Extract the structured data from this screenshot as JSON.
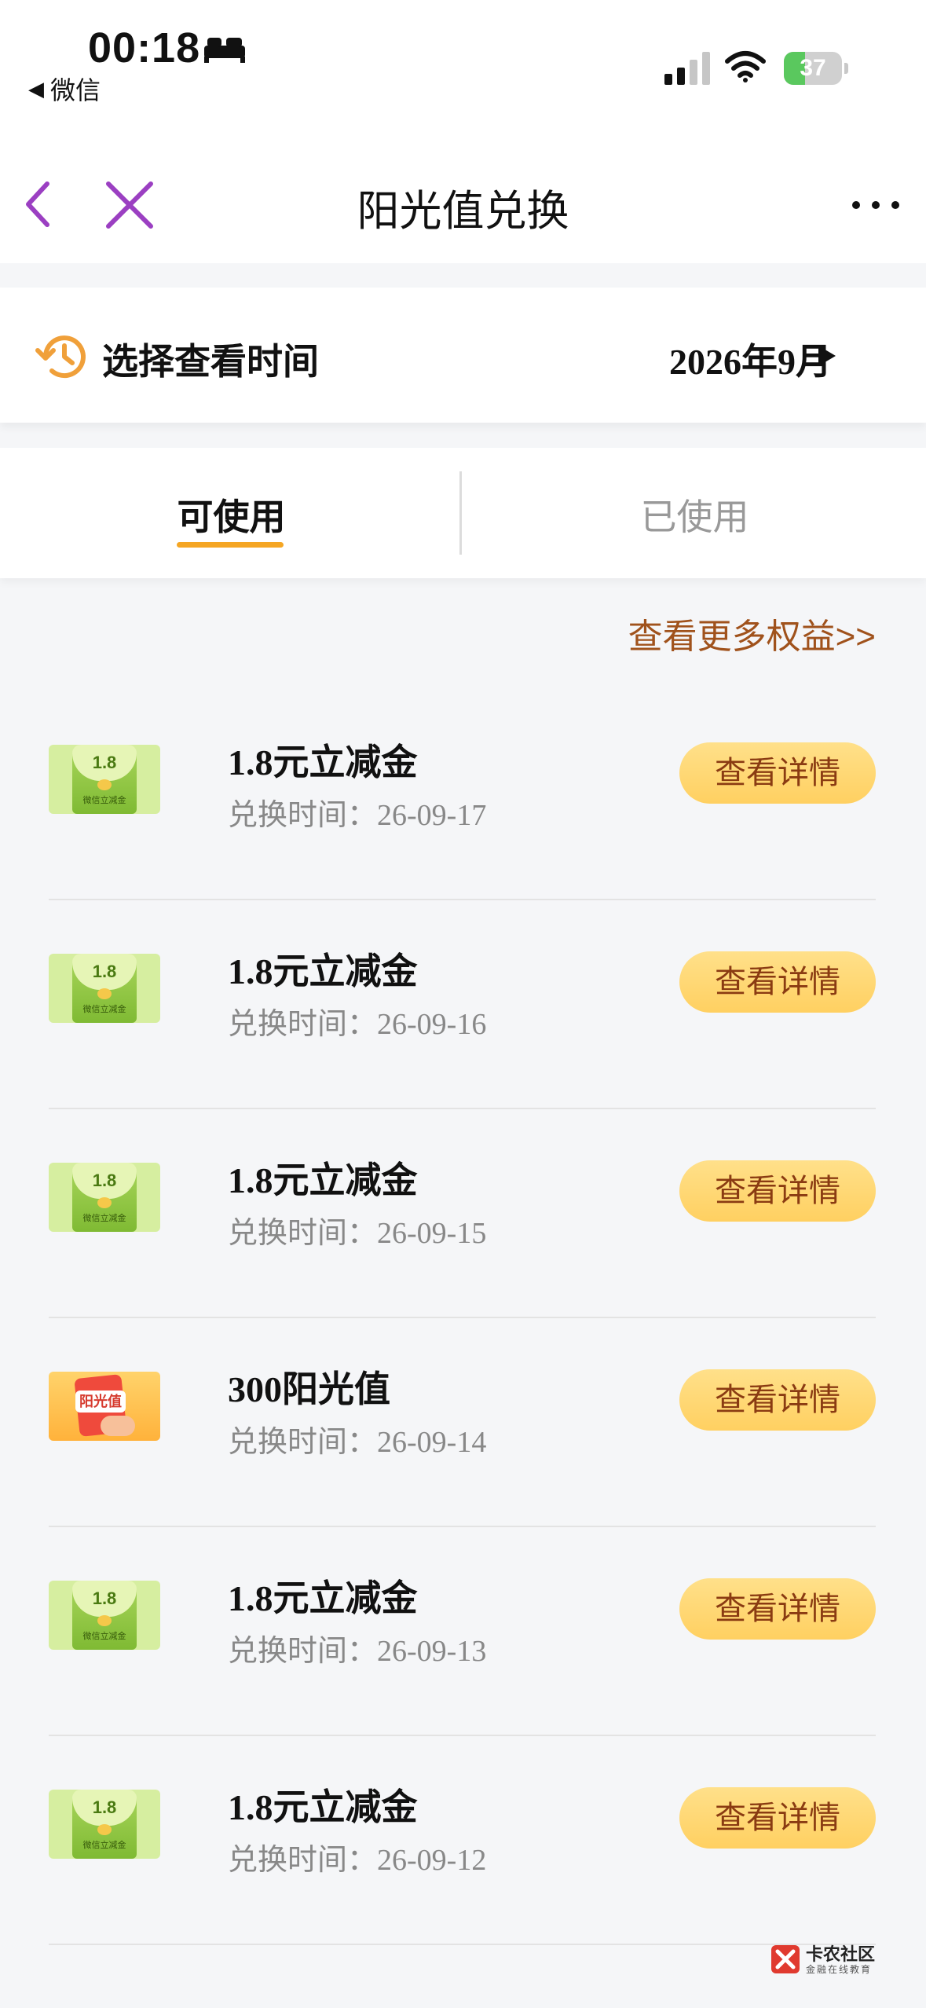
{
  "status_bar": {
    "time": "00:18",
    "back_app": "微信",
    "battery": "37",
    "battery_level": 0.37
  },
  "nav": {
    "title": "阳光值兑换"
  },
  "month_selector": {
    "label": "选择查看时间",
    "value": "2026年9月"
  },
  "tabs": [
    {
      "label": "可使用",
      "active": true
    },
    {
      "label": "已使用",
      "active": false
    }
  ],
  "more_link": "查看更多权益>>",
  "date_prefix": "兑换时间：",
  "items": [
    {
      "title": "1.8元立减金",
      "date": "26-09-17",
      "thumb_type": "green",
      "thumb_amount": "1.8",
      "thumb_caption": "微信立减金",
      "button": "查看详情"
    },
    {
      "title": "1.8元立减金",
      "date": "26-09-16",
      "thumb_type": "green",
      "thumb_amount": "1.8",
      "thumb_caption": "微信立减金",
      "button": "查看详情"
    },
    {
      "title": "1.8元立减金",
      "date": "26-09-15",
      "thumb_type": "green",
      "thumb_amount": "1.8",
      "thumb_caption": "微信立减金",
      "button": "查看详情"
    },
    {
      "title": "300阳光值",
      "date": "26-09-14",
      "thumb_type": "sun",
      "thumb_amount": "阳光值",
      "thumb_caption": "",
      "button": "查看详情"
    },
    {
      "title": "1.8元立减金",
      "date": "26-09-13",
      "thumb_type": "green",
      "thumb_amount": "1.8",
      "thumb_caption": "微信立减金",
      "button": "查看详情"
    },
    {
      "title": "1.8元立减金",
      "date": "26-09-12",
      "thumb_type": "green",
      "thumb_amount": "1.8",
      "thumb_caption": "微信立减金",
      "button": "查看详情"
    }
  ],
  "watermark": {
    "name": "卡农社区",
    "sub": "金融在线教育"
  },
  "colors": {
    "accent": "#f5a623",
    "button_bg": "#ffd061",
    "button_text": "#8a3b12",
    "link": "#a0521c",
    "nav_icon": "#9b3fc2"
  }
}
